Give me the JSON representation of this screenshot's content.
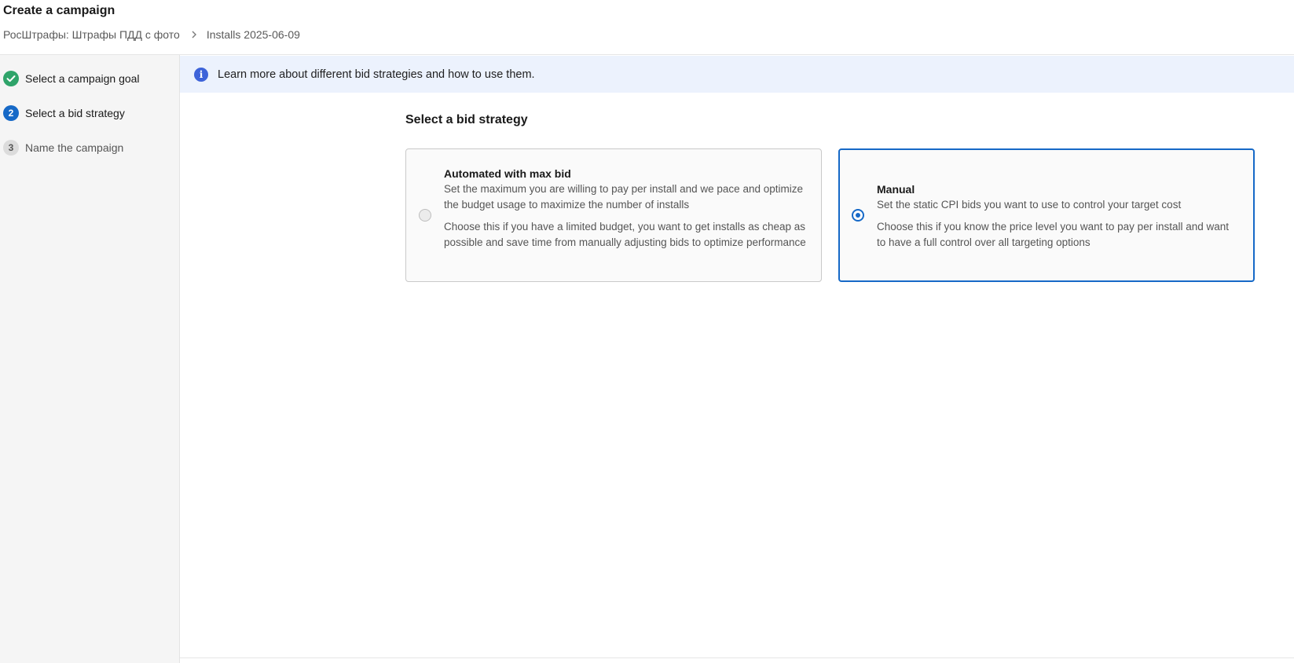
{
  "header": {
    "title": "Create a campaign",
    "breadcrumb": {
      "app": "РосШтрафы: Штрафы ПДД с фото",
      "campaign": "Installs 2025-06-09"
    }
  },
  "steps": [
    {
      "number": "1",
      "label": "Select a campaign goal",
      "state": "done"
    },
    {
      "number": "2",
      "label": "Select a bid strategy",
      "state": "active"
    },
    {
      "number": "3",
      "label": "Name the campaign",
      "state": "pending"
    }
  ],
  "banner": {
    "icon": "info-icon",
    "text": "Learn more about different bid strategies and how to use them."
  },
  "main": {
    "section_title": "Select a bid strategy",
    "options": [
      {
        "title": "Automated with max bid",
        "description": "Set the maximum you are willing to pay per install and we pace and optimize the budget usage to maximize the number of installs",
        "hint": "Choose this if you have a limited budget, you want to get installs as cheap as possible and save time from manually adjusting bids to optimize performance",
        "selected": false
      },
      {
        "title": "Manual",
        "description": "Set the static CPI bids you want to use to control your target cost",
        "hint": "Choose this if you know the price level you want to pay per install and want to have a full control over all targeting options",
        "selected": true
      }
    ]
  },
  "colors": {
    "accent": "#1669c7",
    "success": "#2fa46a",
    "banner_bg": "#ecf2fd",
    "info": "#3d63d9"
  }
}
